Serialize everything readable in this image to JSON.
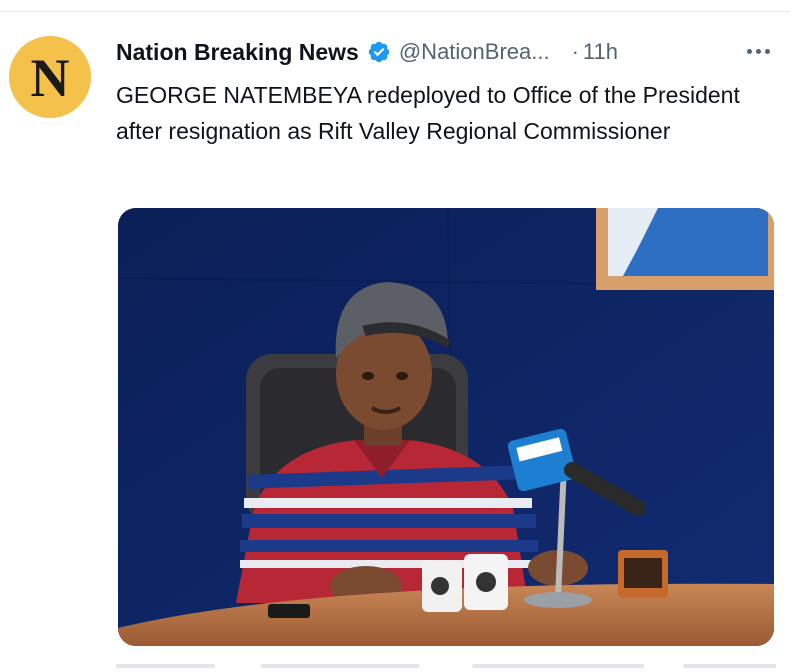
{
  "tweet": {
    "avatar_letter": "N",
    "display_name": "Nation Breaking News",
    "verified": true,
    "handle": "@NationBrea...",
    "separator": "·",
    "time": "11h",
    "text": "GEORGE NATEMBEYA redeployed to Office of the President after resignation as Rift Valley Regional Commissioner"
  },
  "icons": {
    "verified": "verified-badge-icon",
    "more": "more-options-icon"
  },
  "colors": {
    "avatar_bg": "#f4c24a",
    "verified_blue": "#1d9bf0",
    "secondary_text": "#536471",
    "photo_wall": "#0d2461"
  }
}
